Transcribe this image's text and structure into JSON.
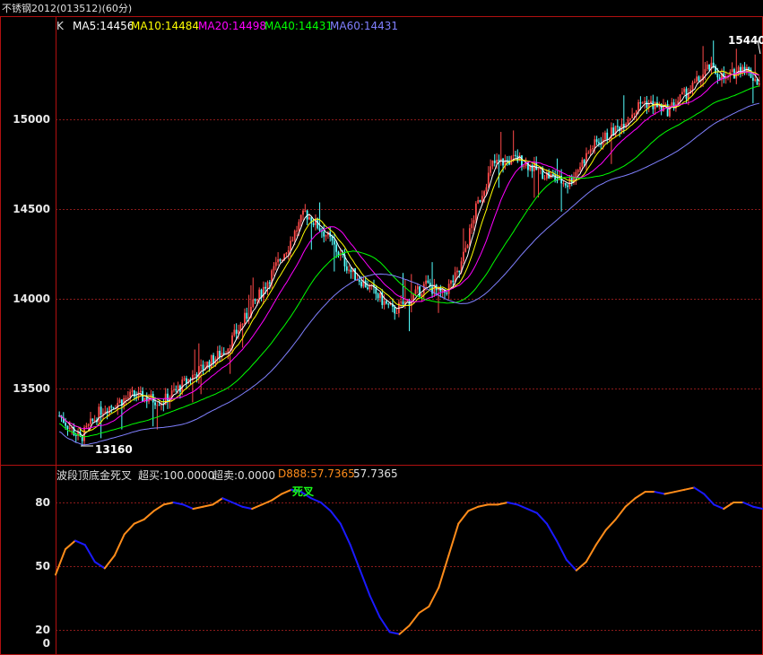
{
  "window": {
    "title": "不锈钢2012(013512)(60分)"
  },
  "main_panel": {
    "legend_prefix": "K",
    "ma_legend": [
      {
        "label": "MA5:14456",
        "color": "#ffffff"
      },
      {
        "label": "MA10:14484",
        "color": "#ffff00"
      },
      {
        "label": "MA20:14498",
        "color": "#ff00ff"
      },
      {
        "label": "MA40:14431",
        "color": "#00ff00"
      },
      {
        "label": "MA60:14431",
        "color": "#8080ff"
      }
    ],
    "y_ticks": [
      "15000",
      "14500",
      "14000",
      "13500"
    ],
    "high_marker": "15440",
    "low_marker": "13160"
  },
  "indicator_panel": {
    "name": "波段顶底金死叉",
    "overbuy": "超买:100.0000",
    "oversell": "超卖:0.0000",
    "d_label": "D888:57.7365",
    "d_value": "57.7365",
    "signal_text": "死叉",
    "y_ticks": [
      "80",
      "50",
      "20",
      "0"
    ]
  },
  "colors": {
    "frame": "#b01010",
    "grid": "#8a1a1a",
    "up_candle": "#ff4a4a",
    "down_candle": "#54ffff",
    "indicator_up": "#ff8c1a",
    "indicator_down": "#1a1aff",
    "signal": "#19ff19"
  },
  "chart_data": [
    {
      "type": "line",
      "title": "",
      "subtype": "candlestick_with_moving_averages",
      "ylim": [
        13160,
        15440
      ],
      "y_gridlines": [
        13500,
        14000,
        14500,
        15000
      ],
      "anchor_points": [
        {
          "bar": 0,
          "price": 13350
        },
        {
          "bar": 10,
          "price": 13220
        },
        {
          "bar": 20,
          "price": 13380
        },
        {
          "bar": 35,
          "price": 13460
        },
        {
          "bar": 50,
          "price": 13430
        },
        {
          "bar": 65,
          "price": 13580
        },
        {
          "bar": 80,
          "price": 13720
        },
        {
          "bar": 95,
          "price": 14000
        },
        {
          "bar": 110,
          "price": 14300
        },
        {
          "bar": 118,
          "price": 14480
        },
        {
          "bar": 128,
          "price": 14360
        },
        {
          "bar": 140,
          "price": 14150
        },
        {
          "bar": 150,
          "price": 14050
        },
        {
          "bar": 160,
          "price": 13930
        },
        {
          "bar": 168,
          "price": 13990
        },
        {
          "bar": 176,
          "price": 14080
        },
        {
          "bar": 184,
          "price": 14020
        },
        {
          "bar": 192,
          "price": 14150
        },
        {
          "bar": 200,
          "price": 14500
        },
        {
          "bar": 208,
          "price": 14750
        },
        {
          "bar": 220,
          "price": 14780
        },
        {
          "bar": 232,
          "price": 14700
        },
        {
          "bar": 244,
          "price": 14640
        },
        {
          "bar": 256,
          "price": 14850
        },
        {
          "bar": 268,
          "price": 14950
        },
        {
          "bar": 280,
          "price": 15100
        },
        {
          "bar": 292,
          "price": 15050
        },
        {
          "bar": 304,
          "price": 15180
        },
        {
          "bar": 312,
          "price": 15290
        },
        {
          "bar": 320,
          "price": 15220
        },
        {
          "bar": 328,
          "price": 15300
        },
        {
          "bar": 336,
          "price": 15200
        }
      ],
      "bars": 337
    },
    {
      "type": "line",
      "title": "",
      "series": [
        {
          "name": "D888",
          "values": [
            46,
            58,
            62,
            60,
            52,
            49,
            55,
            65,
            70,
            72,
            76,
            79,
            80,
            79,
            77,
            78,
            79,
            82,
            80,
            78,
            77,
            79,
            81,
            84,
            86,
            85,
            82,
            80,
            76,
            70,
            60,
            48,
            36,
            26,
            19,
            18,
            22,
            28,
            31,
            40,
            55,
            70,
            76,
            78,
            79,
            79,
            80,
            79,
            77,
            75,
            70,
            62,
            53,
            48,
            52,
            60,
            67,
            72,
            78,
            82,
            85,
            85,
            84,
            85,
            86,
            87,
            84,
            79,
            77,
            80,
            80,
            78,
            77
          ]
        }
      ],
      "ylim": [
        0,
        100
      ],
      "y_gridlines": [
        20,
        50,
        80
      ]
    }
  ]
}
